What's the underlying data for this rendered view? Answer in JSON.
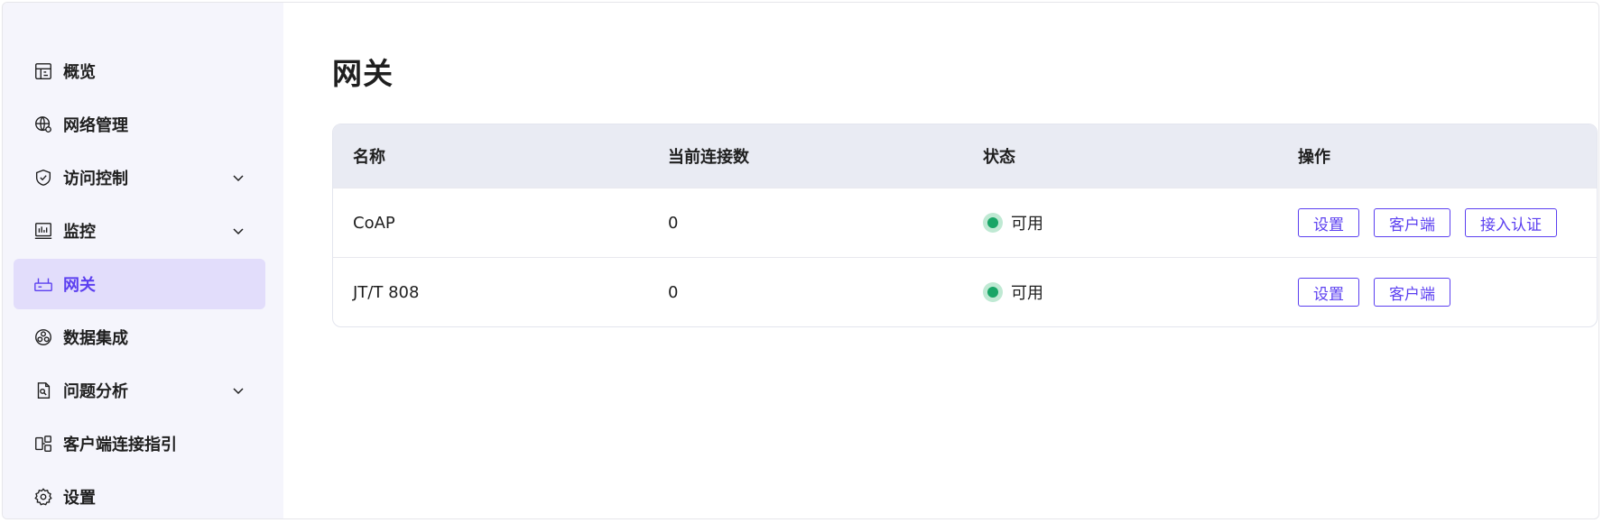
{
  "sidebar": {
    "items": [
      {
        "label": "概览",
        "icon": "dashboard-icon",
        "expandable": false,
        "active": false
      },
      {
        "label": "网络管理",
        "icon": "network-icon",
        "expandable": false,
        "active": false
      },
      {
        "label": "访问控制",
        "icon": "shield-icon",
        "expandable": true,
        "active": false
      },
      {
        "label": "监控",
        "icon": "monitor-chart-icon",
        "expandable": true,
        "active": false
      },
      {
        "label": "网关",
        "icon": "gateway-icon",
        "expandable": false,
        "active": true
      },
      {
        "label": "数据集成",
        "icon": "data-integration-icon",
        "expandable": false,
        "active": false
      },
      {
        "label": "问题分析",
        "icon": "file-analysis-icon",
        "expandable": true,
        "active": false
      },
      {
        "label": "客户端连接指引",
        "icon": "client-guide-icon",
        "expandable": false,
        "active": false
      },
      {
        "label": "设置",
        "icon": "gear-icon",
        "expandable": false,
        "active": false
      }
    ]
  },
  "main": {
    "title": "网关",
    "table": {
      "headers": [
        "名称",
        "当前连接数",
        "状态",
        "操作"
      ],
      "rows": [
        {
          "name": "CoAP",
          "connections": "0",
          "status": "可用",
          "actions": [
            "设置",
            "客户端",
            "接入认证"
          ]
        },
        {
          "name": "JT/T 808",
          "connections": "0",
          "status": "可用",
          "actions": [
            "设置",
            "客户端"
          ]
        }
      ]
    }
  },
  "colors": {
    "accent": "#5b3ff0",
    "sidebar_bg": "#f5f5fc",
    "active_bg": "#e2ddfb",
    "status_ok": "#18a566",
    "table_header_bg": "#e9ebf3"
  }
}
